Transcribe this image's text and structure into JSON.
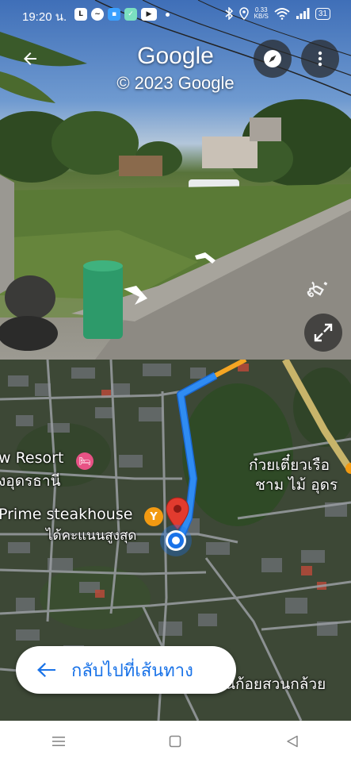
{
  "status_bar": {
    "time": "19:20 น.",
    "speed_value": "0.33",
    "speed_unit": "KB/S",
    "battery": "31"
  },
  "street_view": {
    "brand": "Google",
    "copyright": "© 2023 Google",
    "icons": {
      "back": "arrow-left-icon",
      "compass": "compass-icon",
      "more": "more-vert-icon",
      "expand": "expand-icon"
    }
  },
  "map": {
    "labels": {
      "resort_line1": "w Resort",
      "resort_line2": "งอุดรธานี",
      "steakhouse": "Prime steakhouse",
      "steakhouse_sub": "ได้คะแนนสูงสุด",
      "noodle_line1": "ก๋วยเตี๋ยวเรือ",
      "noodle_line2": "ชาม ไม้ อุดร",
      "bottom_place": "นก้อยสวนกล้วย"
    },
    "colors": {
      "route": "#2f8cf2",
      "traffic": "#f5a623",
      "main_road": "#c8b46a",
      "pin": "#e23b2e",
      "location_dot": "#1a73e8"
    }
  },
  "return_button": {
    "label": "กลับไปที่เส้นทาง"
  },
  "nav_bar": {
    "icons": [
      "menu-icon",
      "home-square-icon",
      "back-triangle-icon"
    ]
  }
}
